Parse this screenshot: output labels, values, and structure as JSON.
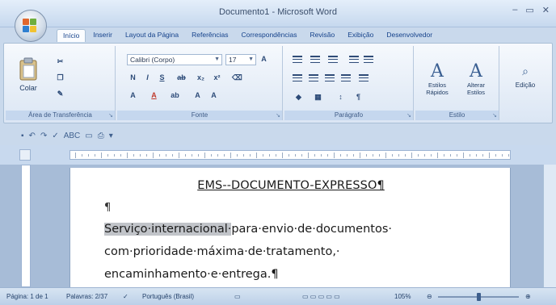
{
  "window": {
    "title": "Documento1 - Microsoft Word",
    "controls": [
      "–",
      "▭",
      "✕"
    ]
  },
  "tabs": [
    {
      "label": "Início",
      "active": true
    },
    {
      "label": "Inserir"
    },
    {
      "label": "Layout da Página"
    },
    {
      "label": "Referências"
    },
    {
      "label": "Correspondências"
    },
    {
      "label": "Revisão"
    },
    {
      "label": "Exibição"
    },
    {
      "label": "Desenvolvedor"
    }
  ],
  "ribbon": {
    "clipboard": {
      "paste_label": "Colar",
      "group_label": "Área de Transferência"
    },
    "font": {
      "font_name": "Calibri (Corpo)",
      "font_size": "17",
      "group_label": "Fonte"
    },
    "paragraph": {
      "group_label": "Parágrafo"
    },
    "styles": {
      "quick_styles": "Estilos Rápidos",
      "change_styles": "Alterar Estilos",
      "group_label": "Estilo"
    },
    "editing": {
      "label": "Edição"
    }
  },
  "document": {
    "title": "EMS--DOCUMENTO-EXPRESSO¶",
    "empty_paragraph": "¶",
    "highlighted": "Serviço·internacional·",
    "line1_rest": "para·envio·de·documentos·",
    "line2": "com·prioridade·máxima·de·tratamento,·",
    "line3": "encaminhamento·e·entrega.¶"
  },
  "statusbar": {
    "page": "Página: 1 de 1",
    "words": "Palavras: 2/37",
    "language": "Português (Brasil)",
    "zoom": "105%"
  },
  "colors": {
    "highlight": "#c1c4c9",
    "ribbon_text": "#15428b"
  }
}
